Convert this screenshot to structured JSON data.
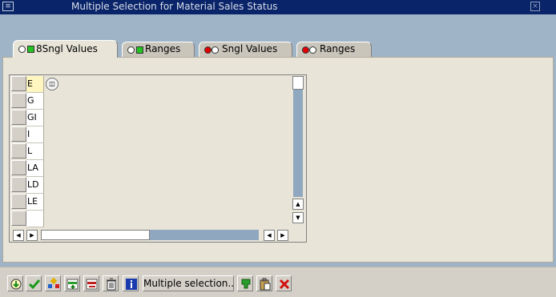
{
  "window": {
    "title": "Multiple Selection for Material Sales Status",
    "system_icon": "sap-window-icon",
    "close_icon": "close-icon"
  },
  "tabs": [
    {
      "label": "8Sngl Values",
      "lamp": "green",
      "active": true
    },
    {
      "label": "Ranges",
      "lamp": "green",
      "active": false
    },
    {
      "label": "Sngl Values",
      "lamp": "red",
      "active": false
    },
    {
      "label": "Ranges",
      "lamp": "red",
      "active": false
    }
  ],
  "grid": {
    "values": [
      "E",
      "G",
      "GI",
      "I",
      "L",
      "LA",
      "LD",
      "LE",
      ""
    ],
    "focused_row": 0,
    "popup_icon": "value-help-icon"
  },
  "toolbar": {
    "multiple_selection_label": "Multiple selection..",
    "buttons": [
      "execute-icon",
      "check-icon",
      "select-all-icon",
      "insert-row-icon",
      "delete-row-icon",
      "trash-icon",
      "info-icon",
      "import-clipboard-icon",
      "paste-icon",
      "cancel-icon"
    ]
  },
  "colors": {
    "lamp_green": "#22c422",
    "lamp_red": "#e00000",
    "title_bar": "#0a246a",
    "background": "#9fb4c7",
    "panel": "#e8e4d8",
    "focused_cell": "#fff6bf"
  }
}
